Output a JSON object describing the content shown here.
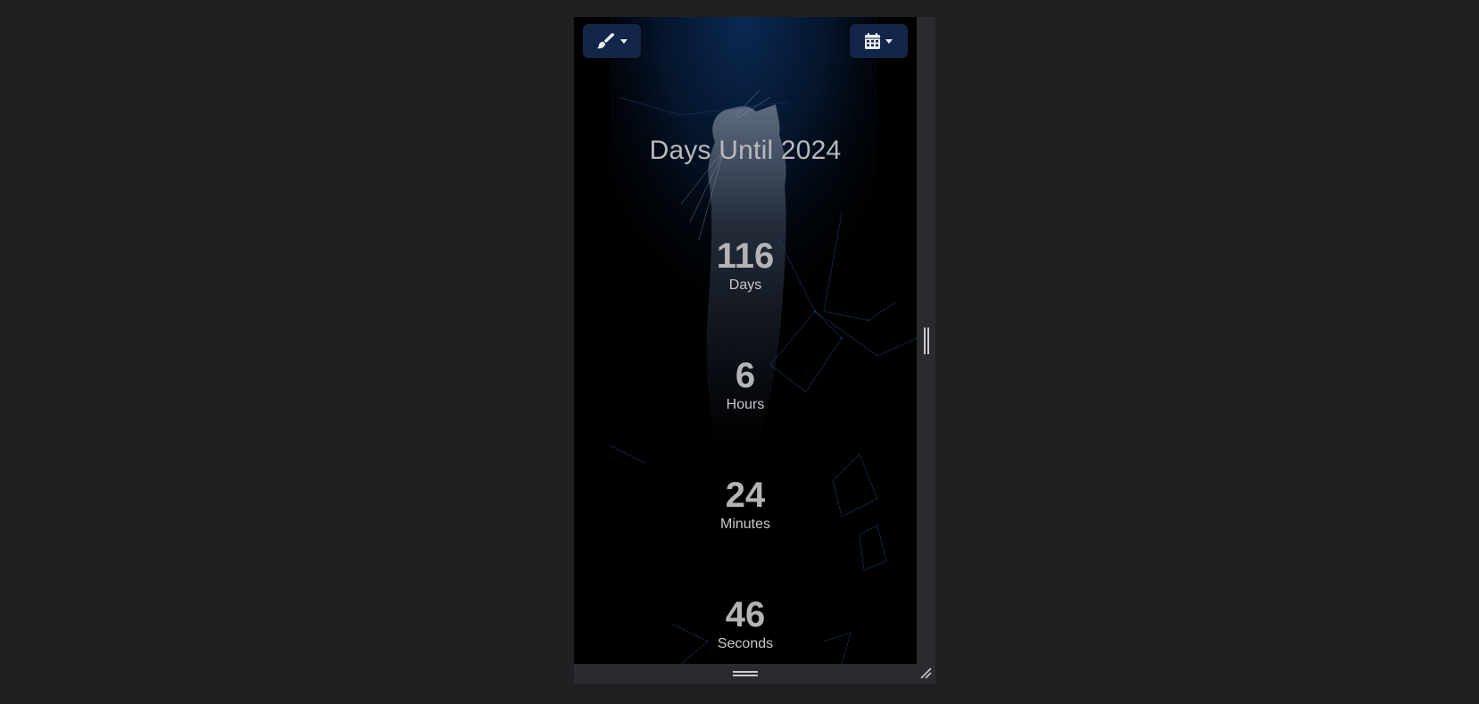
{
  "toolbar": {
    "theme_button": {
      "icon": "paintbrush-icon"
    },
    "date_button": {
      "icon": "calendar-icon"
    }
  },
  "countdown": {
    "title": "Days Until 2024",
    "units": [
      {
        "value": "116",
        "label": "Days"
      },
      {
        "value": "6",
        "label": "Hours"
      },
      {
        "value": "24",
        "label": "Minutes"
      },
      {
        "value": "46",
        "label": "Seconds"
      }
    ]
  },
  "colors": {
    "page_background": "#202022",
    "button_background": "#13264a",
    "text": "#b8b9bb",
    "accent_glow": "#0b2a55"
  }
}
